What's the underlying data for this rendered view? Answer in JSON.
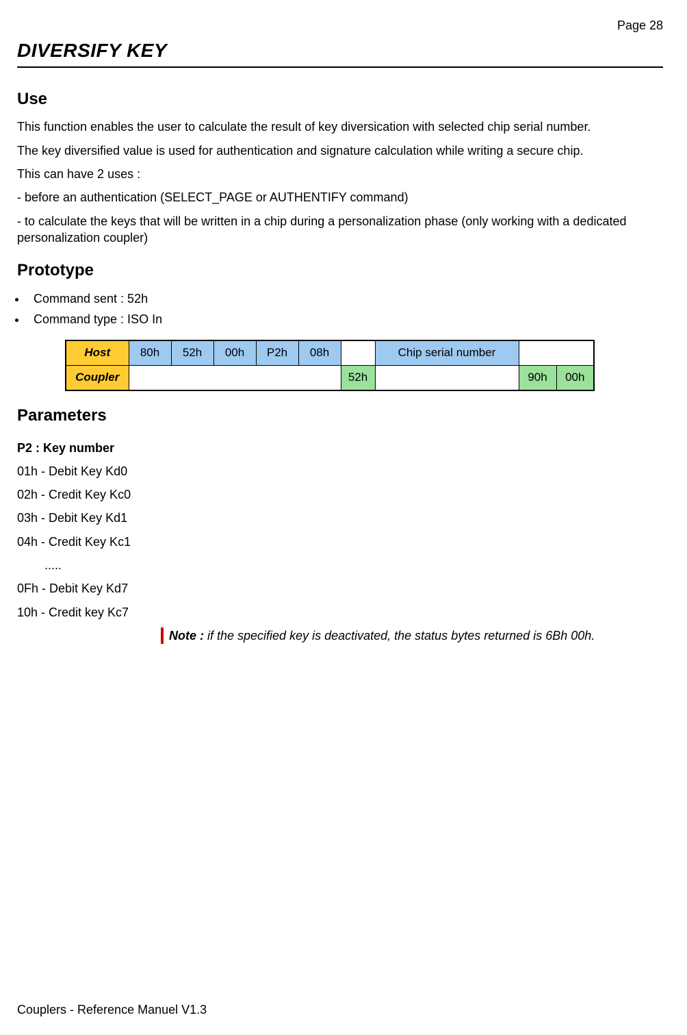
{
  "page_number": "Page 28",
  "title": "DIVERSIFY KEY",
  "sections": {
    "use_heading": "Use",
    "use_p1": "This function enables the user to calculate the result of key diversication with selected chip serial number.",
    "use_p2": "The key diversified value is used for authentication and signature calculation while writing a secure chip.",
    "use_p3": "This can have 2 uses :",
    "use_p4": "- before an authentication (SELECT_PAGE or AUTHENTIFY command)",
    "use_p5": "- to calculate the keys that will be written in a chip during a personalization phase (only working with a dedicated personalization coupler)",
    "proto_heading": "Prototype",
    "proto_b1": "Command sent : 52h",
    "proto_b2": "Command type : ISO In",
    "params_heading": "Parameters",
    "p2_heading": "P2 : Key number",
    "params": {
      "l1": "01h - Debit Key Kd0",
      "l2": "02h - Credit Key Kc0",
      "l3": "03h - Debit Key Kd1",
      "l4": "04h - Credit Key Kc1",
      "dots": ".....",
      "l5": "0Fh - Debit Key Kd7",
      "l6": "10h - Credit key Kc7"
    },
    "note_label": "Note : ",
    "note_text": "if the specified key is deactivated, the status bytes returned is 6Bh 00h."
  },
  "table": {
    "host_label": "Host",
    "coupler_label": "Coupler",
    "host_cells": {
      "c1": "80h",
      "c2": "52h",
      "c3": "00h",
      "c4": "P2h",
      "c5": "08h",
      "serial": "Chip serial number"
    },
    "coupler_cells": {
      "ack": "52h",
      "sw1": "90h",
      "sw2": "00h"
    }
  },
  "footer": "Couplers - Reference Manuel V1.3"
}
